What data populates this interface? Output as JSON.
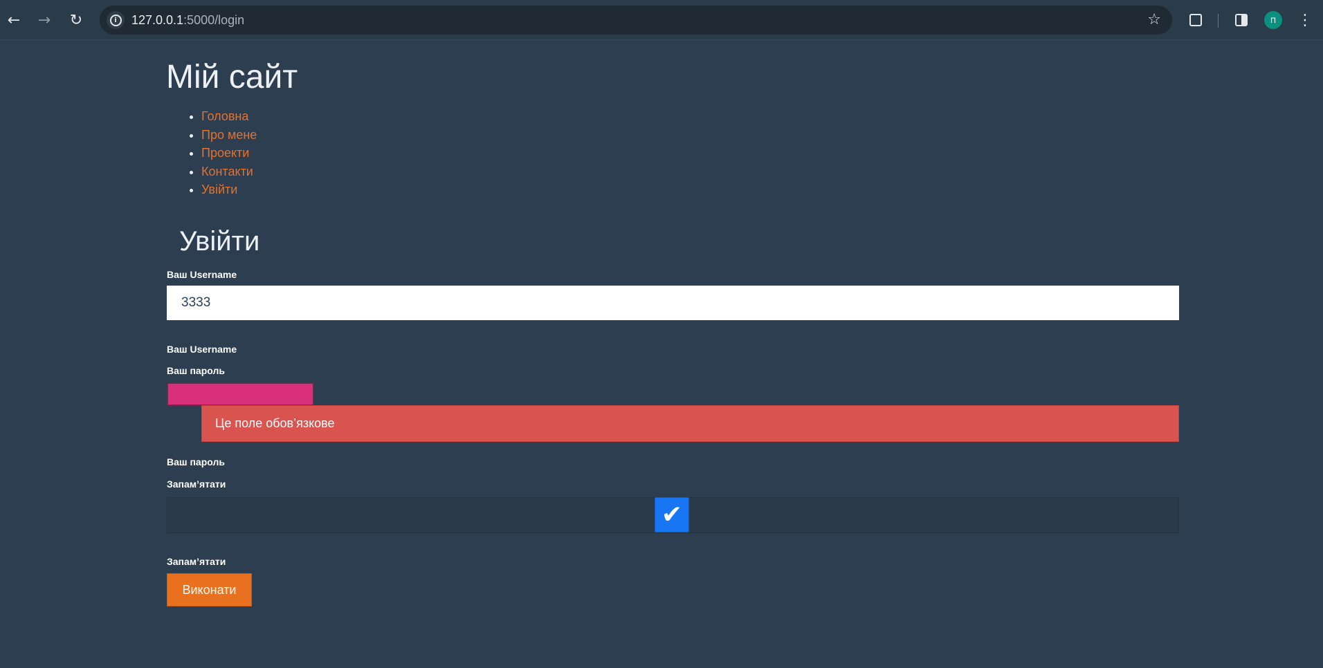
{
  "browser": {
    "url_host": "127.0.0.1",
    "url_path": ":5000/login",
    "profile_initial": "п",
    "icons": {
      "back": "arrow-left-icon",
      "forward": "arrow-right-icon",
      "reload": "reload-icon",
      "site_info": "info-icon",
      "bookmark": "star-icon",
      "extensions": "puzzle-icon",
      "side_panel": "side-panel-icon",
      "menu": "kebab-menu-icon"
    }
  },
  "site": {
    "title": "Мій сайт",
    "nav": [
      {
        "label": "Головна"
      },
      {
        "label": "Про мене"
      },
      {
        "label": "Проекти"
      },
      {
        "label": "Контакти"
      },
      {
        "label": "Увійти"
      }
    ]
  },
  "form": {
    "heading": "Увійти",
    "username_label": "Ваш Username",
    "username_value": "3333",
    "username_label_after": "Ваш Username",
    "password_label": "Ваш пароль",
    "password_error": "Це поле обов’язкове",
    "password_label_after": "Ваш пароль",
    "remember_label": "Запам’ятати",
    "remember_checked": true,
    "remember_label_after": "Запам’ятати",
    "submit_label": "Виконати"
  },
  "colors": {
    "page_bg": "#2c3e50",
    "link": "#e8702a",
    "error_bg": "#d9534f",
    "password_field": "#d8307a",
    "checkbox": "#1976f2",
    "submit_bg": "#e8701e"
  }
}
